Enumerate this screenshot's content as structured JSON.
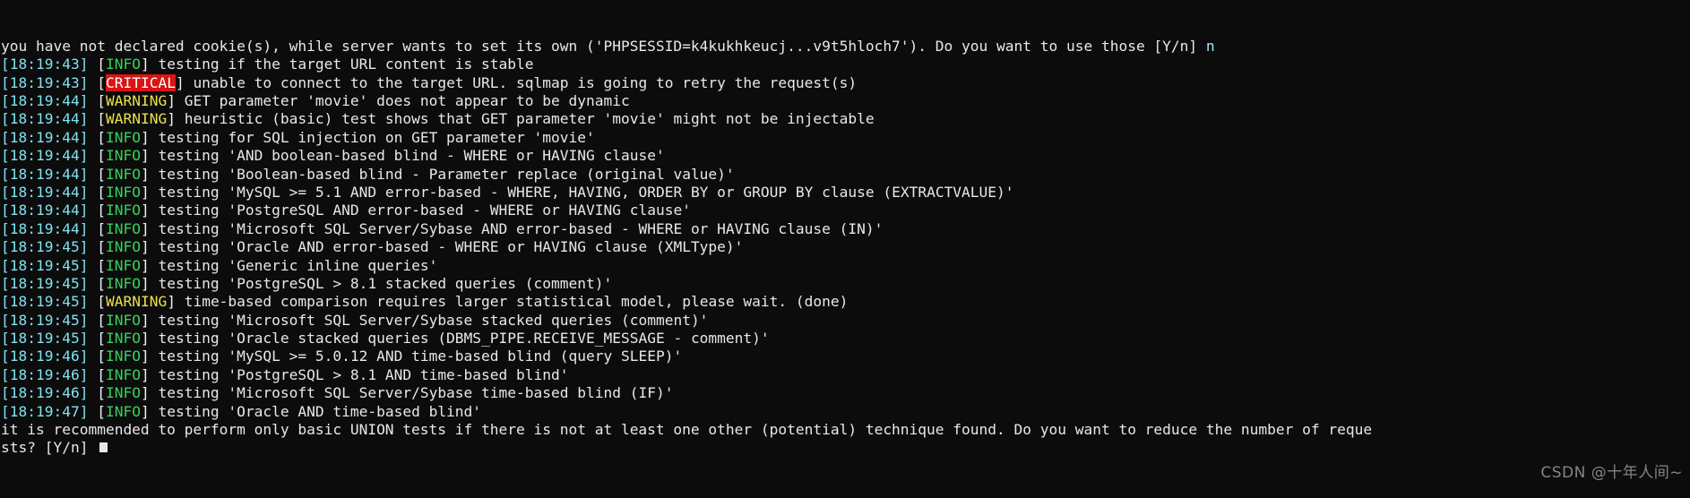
{
  "terminal": {
    "program": "sqlmap",
    "background_color": "#0c0c0c",
    "foreground_color": "#e8e8e8",
    "font_size_px": 16,
    "line_height_px": 20,
    "colors": {
      "timestamp": "#7fe3f0",
      "info": "#35d35b",
      "warning": "#ece04a",
      "critical_fg": "#ffffff",
      "critical_bg": "#d91414",
      "plain": "#e8e8e8",
      "prompt_answer": "#9fe8f5"
    },
    "cursor": {
      "visible": true,
      "style": "block"
    }
  },
  "lines": [
    {
      "id": "line-0-cookie-prompt",
      "segments": [
        {
          "style": "plain",
          "text": "you have not declared cookie(s), while server wants to set its own ('PHPSESSID=k4kukhkeucj...v9t5hloch7'). Do you want to use those [Y/n] "
        },
        {
          "style": "answer",
          "text": "n"
        }
      ]
    },
    {
      "id": "line-1",
      "time": "[18:19:43]",
      "level": "INFO",
      "message": "testing if the target URL content is stable"
    },
    {
      "id": "line-2",
      "time": "[18:19:43]",
      "level": "CRITICAL",
      "message": "unable to connect to the target URL. sqlmap is going to retry the request(s)"
    },
    {
      "id": "line-3",
      "time": "[18:19:44]",
      "level": "WARNING",
      "message": "GET parameter 'movie' does not appear to be dynamic"
    },
    {
      "id": "line-4",
      "time": "[18:19:44]",
      "level": "WARNING",
      "message": "heuristic (basic) test shows that GET parameter 'movie' might not be injectable"
    },
    {
      "id": "line-5",
      "time": "[18:19:44]",
      "level": "INFO",
      "message": "testing for SQL injection on GET parameter 'movie'"
    },
    {
      "id": "line-6",
      "time": "[18:19:44]",
      "level": "INFO",
      "message": "testing 'AND boolean-based blind - WHERE or HAVING clause'"
    },
    {
      "id": "line-7",
      "time": "[18:19:44]",
      "level": "INFO",
      "message": "testing 'Boolean-based blind - Parameter replace (original value)'"
    },
    {
      "id": "line-8",
      "time": "[18:19:44]",
      "level": "INFO",
      "message": "testing 'MySQL >= 5.1 AND error-based - WHERE, HAVING, ORDER BY or GROUP BY clause (EXTRACTVALUE)'"
    },
    {
      "id": "line-9",
      "time": "[18:19:44]",
      "level": "INFO",
      "message": "testing 'PostgreSQL AND error-based - WHERE or HAVING clause'"
    },
    {
      "id": "line-10",
      "time": "[18:19:44]",
      "level": "INFO",
      "message": "testing 'Microsoft SQL Server/Sybase AND error-based - WHERE or HAVING clause (IN)'"
    },
    {
      "id": "line-11",
      "time": "[18:19:45]",
      "level": "INFO",
      "message": "testing 'Oracle AND error-based - WHERE or HAVING clause (XMLType)'"
    },
    {
      "id": "line-12",
      "time": "[18:19:45]",
      "level": "INFO",
      "message": "testing 'Generic inline queries'"
    },
    {
      "id": "line-13",
      "time": "[18:19:45]",
      "level": "INFO",
      "message": "testing 'PostgreSQL > 8.1 stacked queries (comment)'"
    },
    {
      "id": "line-14",
      "time": "[18:19:45]",
      "level": "WARNING",
      "message": "time-based comparison requires larger statistical model, please wait. (done)"
    },
    {
      "id": "line-15",
      "time": "[18:19:45]",
      "level": "INFO",
      "message": "testing 'Microsoft SQL Server/Sybase stacked queries (comment)'"
    },
    {
      "id": "line-16",
      "time": "[18:19:45]",
      "level": "INFO",
      "message": "testing 'Oracle stacked queries (DBMS_PIPE.RECEIVE_MESSAGE - comment)'"
    },
    {
      "id": "line-17",
      "time": "[18:19:46]",
      "level": "INFO",
      "message": "testing 'MySQL >= 5.0.12 AND time-based blind (query SLEEP)'"
    },
    {
      "id": "line-18",
      "time": "[18:19:46]",
      "level": "INFO",
      "message": "testing 'PostgreSQL > 8.1 AND time-based blind'"
    },
    {
      "id": "line-19",
      "time": "[18:19:46]",
      "level": "INFO",
      "message": "testing 'Microsoft SQL Server/Sybase time-based blind (IF)'"
    },
    {
      "id": "line-20",
      "time": "[18:19:47]",
      "level": "INFO",
      "message": "testing 'Oracle AND time-based blind'"
    },
    {
      "id": "line-21-union-prompt-a",
      "segments": [
        {
          "style": "plain",
          "text": "it is recommended to perform only basic UNION tests if there is not at least one other (potential) technique found. Do you want to reduce the number of reque"
        }
      ]
    },
    {
      "id": "line-22-union-prompt-b",
      "segments": [
        {
          "style": "plain",
          "text": "sts? [Y/n] "
        }
      ],
      "cursor": true
    }
  ],
  "watermark": {
    "text": "CSDN @十年人间~"
  }
}
